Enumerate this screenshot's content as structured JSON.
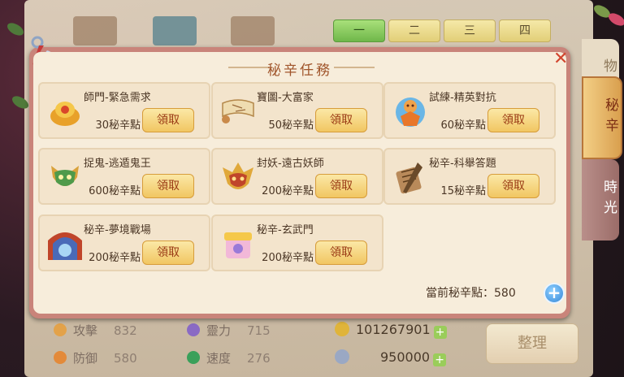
{
  "background": {
    "tabs": [
      {
        "label": "一",
        "active": true
      },
      {
        "label": "二",
        "active": false
      },
      {
        "label": "三",
        "active": false
      },
      {
        "label": "四",
        "active": false
      }
    ],
    "side_tabs": {
      "items": "物",
      "secret": "秘辛",
      "time": "時光"
    },
    "stats": [
      {
        "name": "攻擊",
        "value": "832"
      },
      {
        "name": "靈力",
        "value": "715"
      },
      {
        "name": "防御",
        "value": "580"
      },
      {
        "name": "速度",
        "value": "276"
      }
    ],
    "currency": [
      {
        "icon": "coin-icon",
        "value": "101267901"
      },
      {
        "icon": "silver-icon",
        "value": "950000"
      }
    ],
    "sort_button": "整理"
  },
  "modal": {
    "title": "秘辛任務",
    "close_glyph": "✕",
    "quests": [
      {
        "title": "師門-緊急需求",
        "points": "30秘辛點",
        "button": "領取",
        "icon": "gold-ingot-icon"
      },
      {
        "title": "寶圖-大富家",
        "points": "50秘辛點",
        "button": "領取",
        "icon": "treasure-map-icon"
      },
      {
        "title": "試練-精英對抗",
        "points": "60秘辛點",
        "button": "領取",
        "icon": "doll-icon"
      },
      {
        "title": "捉鬼-逃遁鬼王",
        "points": "600秘辛點",
        "button": "領取",
        "icon": "ghost-mask-icon"
      },
      {
        "title": "封妖-遠古妖師",
        "points": "200秘辛點",
        "button": "領取",
        "icon": "demon-mask-icon"
      },
      {
        "title": "秘辛-科舉答題",
        "points": "15秘辛點",
        "button": "領取",
        "icon": "scroll-brush-icon"
      },
      {
        "title": "秘辛-夢境戰場",
        "points": "200秘辛點",
        "button": "領取",
        "icon": "dream-gate-icon"
      },
      {
        "title": "秘辛-玄武門",
        "points": "200秘辛點",
        "button": "領取",
        "icon": "gift-box-icon"
      }
    ],
    "current_points_label": "當前秘辛點：580",
    "add_glyph": "+"
  },
  "colors": {
    "accent": "#a0552b",
    "button": "#f1c662",
    "close": "#d2452e",
    "add": "#3588d8"
  }
}
